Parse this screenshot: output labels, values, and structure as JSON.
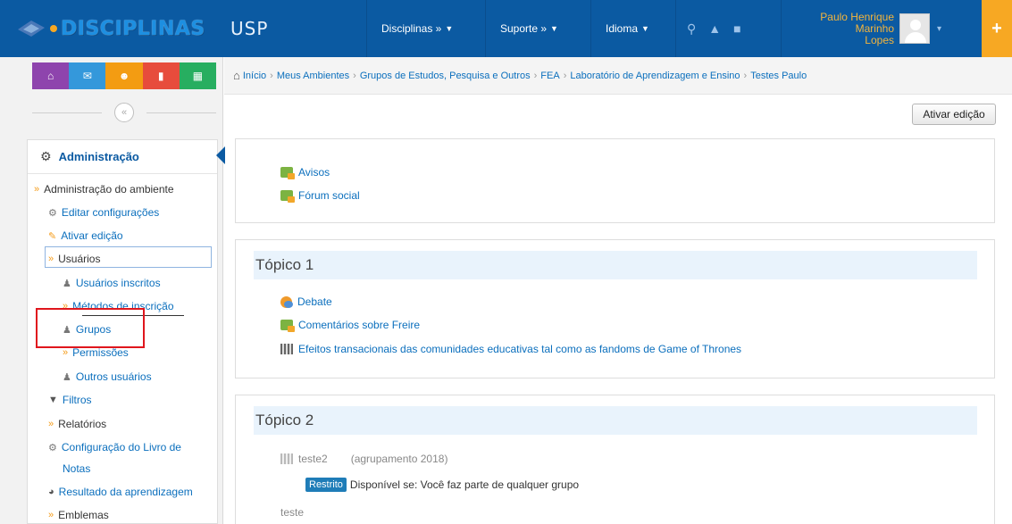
{
  "header": {
    "brand": "DISCIPLINAS",
    "usp": "USP",
    "nav": [
      {
        "label": "Disciplinas »"
      },
      {
        "label": "Suporte »"
      },
      {
        "label": "Idioma"
      }
    ],
    "user_name_line1": "Paulo Henrique Marinho",
    "user_name_line2": "Lopes",
    "plus": "+"
  },
  "sidebar": {
    "quick": [
      {
        "icon": "home-icon",
        "glyph": "⌂",
        "color": "#8e44ad"
      },
      {
        "icon": "mail-icon",
        "glyph": "✉",
        "color": "#3498db"
      },
      {
        "icon": "people-icon",
        "glyph": "☻",
        "color": "#f39c12"
      },
      {
        "icon": "file-icon",
        "glyph": "▮",
        "color": "#e74c3c"
      },
      {
        "icon": "grid-icon",
        "glyph": "▦",
        "color": "#27ae60"
      }
    ],
    "collapse": "«",
    "admin_title": "Administração",
    "items": {
      "amb": "Administração do ambiente",
      "editar": "Editar configurações",
      "ativar": "Ativar edição",
      "usuarios": "Usuários",
      "inscritos": "Usuários inscritos",
      "metodos": "Métodos de inscrição",
      "grupos": "Grupos",
      "permissoes": "Permissões",
      "outros": "Outros usuários",
      "filtros": "Filtros",
      "relatorios": "Relatórios",
      "config_livro_1": "Configuração do Livro de",
      "config_livro_2": "Notas",
      "resultado": "Resultado da aprendizagem",
      "emblemas": "Emblemas"
    }
  },
  "breadcrumb": {
    "items": [
      "Início",
      "Meus Ambientes",
      "Grupos de Estudos, Pesquisa e Outros",
      "FEA",
      "Laboratório de Aprendizagem e Ensino",
      "Testes Paulo"
    ]
  },
  "main": {
    "edit_button": "Ativar edição",
    "section0": {
      "a1": "Avisos",
      "a2": "Fórum social"
    },
    "section1": {
      "title": "Tópico 1",
      "a1": "Debate",
      "a2": "Comentários sobre Freire",
      "a3": "Efeitos transacionais das comunidades educativas tal como as fandoms de Game of Thrones"
    },
    "section2": {
      "title": "Tópico 2",
      "a1": "teste2",
      "grouping": "(agrupamento 2018)",
      "badge": "Restrito",
      "restriction": "Disponível se: Você faz parte de qualquer grupo",
      "a2": "teste"
    }
  }
}
